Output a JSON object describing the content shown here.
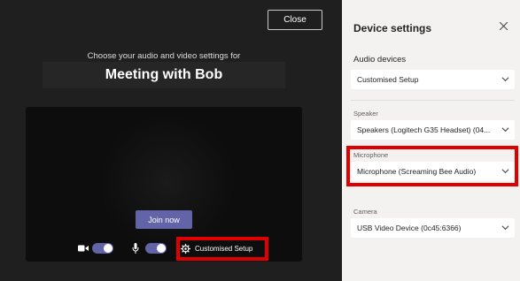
{
  "left": {
    "close_label": "Close",
    "subtitle": "Choose your audio and video settings for",
    "meeting_title": "Meeting with Bob",
    "join_label": "Join now",
    "custom_setup_label": "Customised Setup"
  },
  "panel": {
    "title": "Device settings",
    "audio_section": "Audio devices",
    "audio_value": "Customised Setup",
    "speaker_label": "Speaker",
    "speaker_value": "Speakers (Logitech G35 Headset) (04...",
    "microphone_label": "Microphone",
    "microphone_value": "Microphone (Screaming Bee Audio)",
    "camera_label": "Camera",
    "camera_value": "USB Video Device (0c45:6366)"
  },
  "colors": {
    "accent": "#6264a7",
    "highlight": "#e00000"
  },
  "icons": {
    "camera": "video-camera-icon",
    "mic": "microphone-icon",
    "settings": "gear-icon",
    "close": "close-icon",
    "dropdown": "chevron-down-icon"
  }
}
